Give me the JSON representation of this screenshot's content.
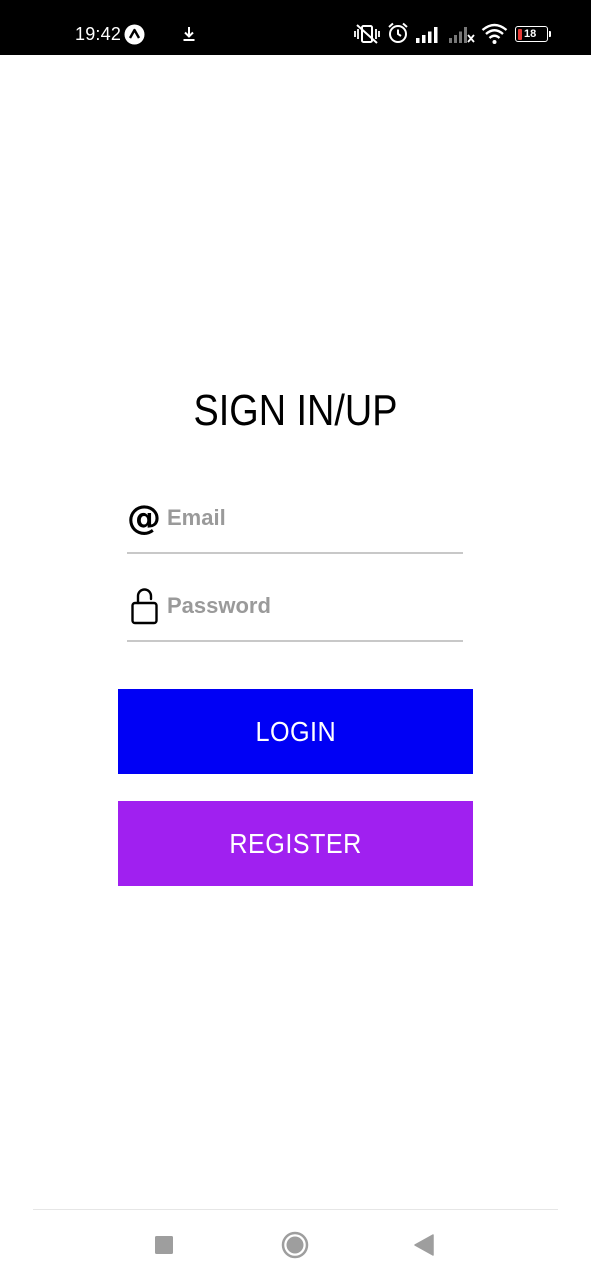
{
  "status_bar": {
    "time": "19:42",
    "battery_level": "18",
    "icons": [
      "app-a-icon",
      "download-icon",
      "vibrate-off-icon",
      "alarm-icon",
      "signal-icon",
      "signal-no-service-icon",
      "wifi-icon",
      "battery-icon"
    ]
  },
  "login": {
    "title": "SIGN IN/UP",
    "email": {
      "placeholder": "Email",
      "value": ""
    },
    "password": {
      "placeholder": "Password",
      "value": ""
    },
    "login_label": "LOGIN",
    "register_label": "REGISTER"
  },
  "nav_bar": {
    "buttons": [
      "recents-button",
      "home-button",
      "back-button"
    ]
  },
  "colors": {
    "login_button": "#0000f5",
    "register_button": "#a020f0",
    "status_bar": "#000000",
    "battery_low": "#e53935"
  }
}
